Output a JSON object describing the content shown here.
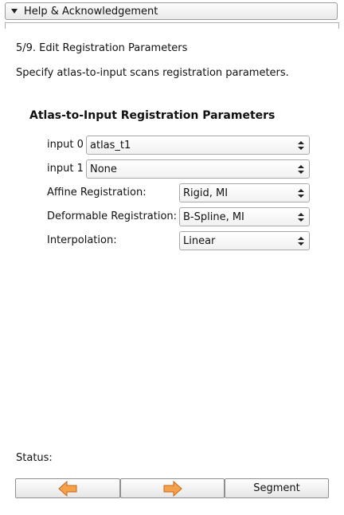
{
  "header": {
    "label": "Help & Acknowledgement"
  },
  "step": {
    "title": "5/9. Edit Registration Parameters",
    "description": "Specify atlas-to-input scans registration parameters."
  },
  "group": {
    "title": "Atlas-to-Input Registration Parameters",
    "rows": [
      {
        "label": "input 0",
        "value": "atlas_t1"
      },
      {
        "label": "input 1",
        "value": "None"
      },
      {
        "label": "Affine Registration:",
        "value": "Rigid, MI"
      },
      {
        "label": "Deformable Registration:",
        "value": "B-Spline, MI"
      },
      {
        "label": "Interpolation:",
        "value": "Linear"
      }
    ]
  },
  "status": {
    "label": "Status:"
  },
  "buttons": {
    "back_icon": "arrow-left-icon",
    "next_icon": "arrow-right-icon",
    "segment_label": "Segment",
    "arrow_color": "#f5a14a"
  }
}
